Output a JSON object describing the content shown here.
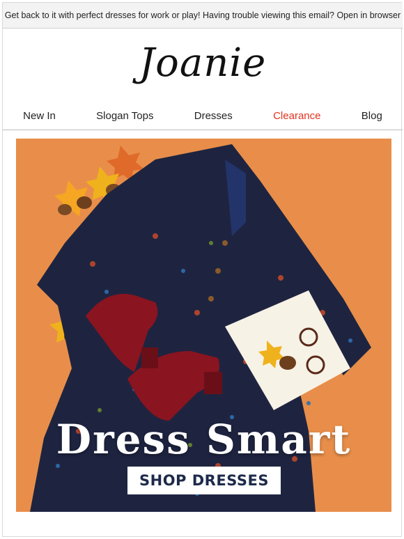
{
  "preheader": {
    "text": "Get back to it with perfect dresses for work or play! Having trouble viewing this email?",
    "link": "Open in browser"
  },
  "brand": {
    "logo_text": "Joanie"
  },
  "nav": {
    "items": [
      {
        "label": "New In"
      },
      {
        "label": "Slogan Tops"
      },
      {
        "label": "Dresses"
      },
      {
        "label": "Clearance",
        "color": "#e2321f"
      },
      {
        "label": "Blog"
      }
    ]
  },
  "hero": {
    "headline": "Dress Smart",
    "cta_label": "SHOP DRESSES",
    "background_color": "#e88e4a",
    "dress_color": "#1e2440",
    "shoe_color": "#8a1420"
  }
}
